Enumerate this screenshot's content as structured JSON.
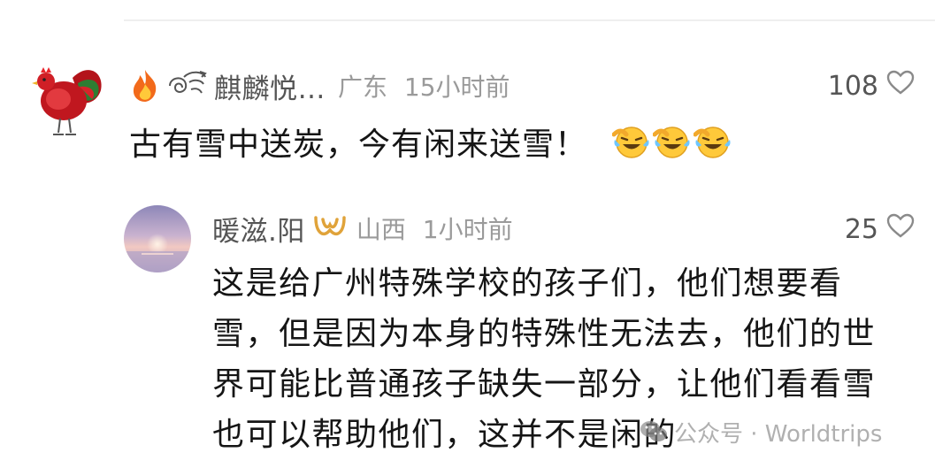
{
  "comment": {
    "username": "麒麟悦…",
    "location": "广东",
    "time": "15小时前",
    "likes": "108",
    "text": "古有雪中送炭，今有闲来送雪！",
    "emoji_icons": [
      "laugh-cry-icon",
      "laugh-cry-icon",
      "laugh-cry-icon"
    ]
  },
  "reply": {
    "username": "暖滋.阳",
    "location": "山西",
    "time": "1小时前",
    "likes": "25",
    "lines": [
      "这是给广州特殊学校的孩子们，他们想要看",
      "雪，但是因为本身的特殊性无法去，他们的世",
      "界可能比普通孩子缺失一部分，让他们看看雪",
      "也可以帮助他们，这并不是闲的"
    ]
  },
  "watermark": {
    "text": "公众号 · Worldtrips"
  },
  "colors": {
    "meta_gray": "#9a9a9a",
    "username_gray": "#555555",
    "text": "#151515",
    "badge_gold": "#e0a33a"
  }
}
